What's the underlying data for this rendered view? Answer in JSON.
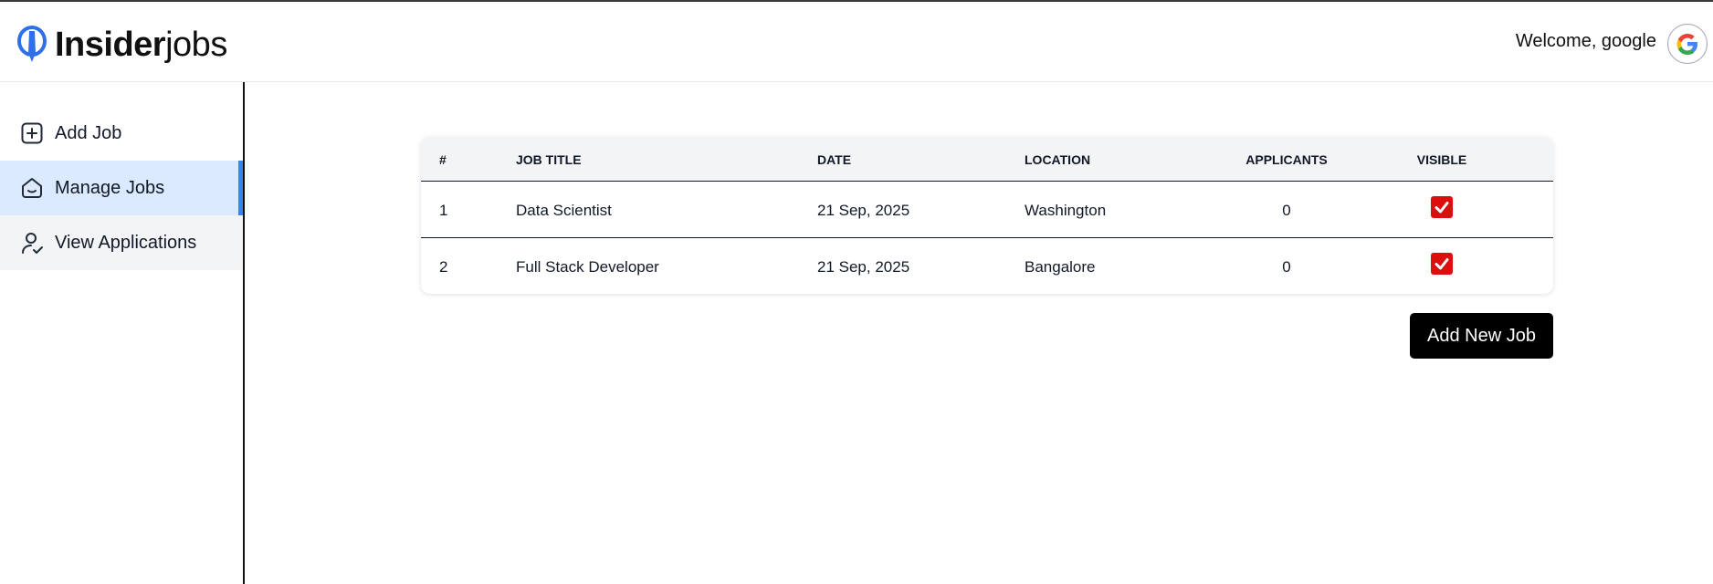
{
  "app": {
    "logo_bold": "Insider",
    "logo_light": "jobs",
    "welcome": "Welcome, google"
  },
  "sidebar": {
    "items": [
      {
        "label": "Add Job",
        "icon": "add-square-icon",
        "state": "normal"
      },
      {
        "label": "Manage Jobs",
        "icon": "home-icon",
        "state": "active"
      },
      {
        "label": "View Applications",
        "icon": "person-check-icon",
        "state": "hover"
      }
    ]
  },
  "table": {
    "headers": [
      "#",
      "JOB TITLE",
      "DATE",
      "LOCATION",
      "APPLICANTS",
      "VISIBLE"
    ],
    "rows": [
      {
        "index": "1",
        "title": "Data Scientist",
        "date": "21 Sep, 2025",
        "location": "Washington",
        "applicants": "0",
        "visible": true
      },
      {
        "index": "2",
        "title": "Full Stack Developer",
        "date": "21 Sep, 2025",
        "location": "Bangalore",
        "applicants": "0",
        "visible": true
      }
    ]
  },
  "actions": {
    "add_new_job": "Add New Job"
  },
  "colors": {
    "brand_blue": "#2f6fea",
    "active_nav_bg": "#dbeafe",
    "active_nav_bar": "#3b82f6",
    "checkbox_red": "#dc0f0f",
    "button_black": "#000000"
  }
}
